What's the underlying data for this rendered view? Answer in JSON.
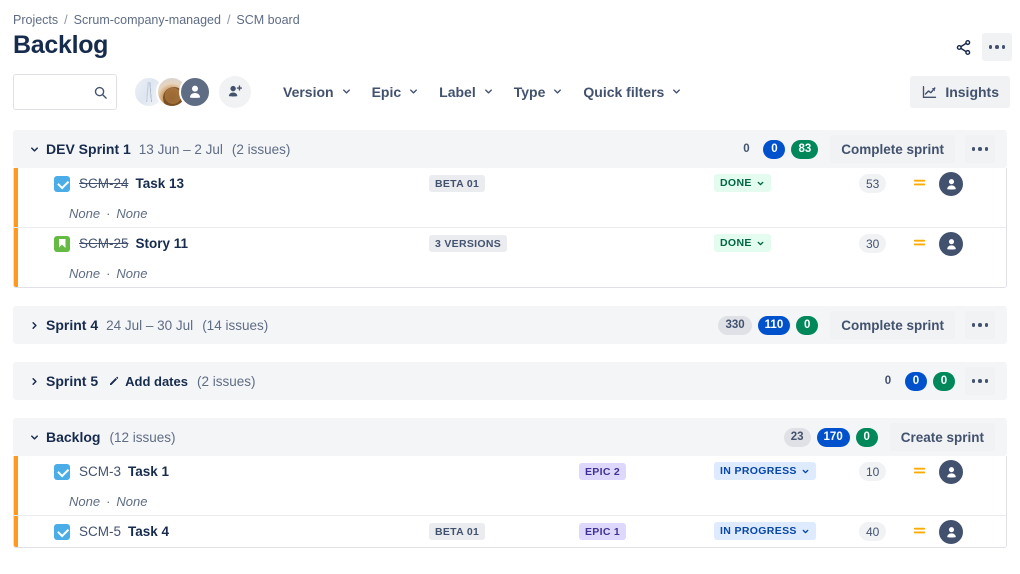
{
  "breadcrumb": {
    "items": [
      "Projects",
      "Scrum-company-managed",
      "SCM board"
    ],
    "separator": "/"
  },
  "page_title": "Backlog",
  "top_actions": {
    "share_icon": "share-icon",
    "more_icon": "more-options-icon"
  },
  "search": {
    "value": "",
    "placeholder": "",
    "icon": "search-icon"
  },
  "avatars": {
    "count": 3,
    "add_person_icon": "add-person-icon"
  },
  "filters": [
    {
      "label": "Version",
      "icon": "chevron-down-icon"
    },
    {
      "label": "Epic",
      "icon": "chevron-down-icon"
    },
    {
      "label": "Label",
      "icon": "chevron-down-icon"
    },
    {
      "label": "Type",
      "icon": "chevron-down-icon"
    },
    {
      "label": "Quick filters",
      "icon": "chevron-down-icon"
    }
  ],
  "insights": {
    "label": "Insights",
    "icon": "insights-chart-icon"
  },
  "colors": {
    "blue_pill": "#0052CC",
    "green_pill": "#00875A",
    "grey_pill": "#DFE1E6",
    "row_accent": "#FF991F",
    "done_bg": "#E3FCEF",
    "done_text": "#006644",
    "inprogress_bg": "#DEEBFF",
    "inprogress_text": "#0747A6",
    "epic_chip_bg": "#DFD8FD",
    "epic_chip_text": "#403294"
  },
  "sections": [
    {
      "id": "dev-sprint-1",
      "name": "DEV Sprint 1",
      "dates": "13 Jun – 2 Jul",
      "count": "(2 issues)",
      "expanded": true,
      "caret": "chevron-down-icon",
      "badges": [
        {
          "value": "0",
          "style": "plain"
        },
        {
          "value": "0",
          "style": "blue"
        },
        {
          "value": "83",
          "style": "green"
        }
      ],
      "action_label": "Complete sprint",
      "menu_icon": "more-options-icon",
      "issues": [
        {
          "type": "task",
          "type_icon": "task-icon",
          "key": "SCM-24",
          "key_done": true,
          "title": "Task 13",
          "sub": [
            "None",
            "None"
          ],
          "version": "BETA 01",
          "epic": "",
          "status": "DONE",
          "status_style": "done",
          "points": "53",
          "priority_icon": "priority-medium-icon",
          "assignee_icon": "assignee-avatar-icon"
        },
        {
          "type": "story",
          "type_icon": "story-icon",
          "key": "SCM-25",
          "key_done": true,
          "title": "Story 11",
          "sub": [
            "None",
            "None"
          ],
          "version": "3 VERSIONS",
          "epic": "",
          "status": "DONE",
          "status_style": "done",
          "points": "30",
          "priority_icon": "priority-medium-icon",
          "assignee_icon": "assignee-avatar-icon"
        }
      ]
    },
    {
      "id": "sprint-4",
      "name": "Sprint 4",
      "dates": "24 Jul – 30 Jul",
      "count": "(14 issues)",
      "expanded": false,
      "caret": "chevron-right-icon",
      "badges": [
        {
          "value": "330",
          "style": "grey"
        },
        {
          "value": "110",
          "style": "blue"
        },
        {
          "value": "0",
          "style": "green"
        }
      ],
      "action_label": "Complete sprint",
      "menu_icon": "more-options-icon",
      "issues": []
    },
    {
      "id": "sprint-5",
      "name": "Sprint 5",
      "dates": "",
      "add_dates_label": "Add dates",
      "add_dates_icon": "pencil-icon",
      "count": "(2 issues)",
      "expanded": false,
      "caret": "chevron-right-icon",
      "badges": [
        {
          "value": "0",
          "style": "plain"
        },
        {
          "value": "0",
          "style": "blue"
        },
        {
          "value": "0",
          "style": "green"
        }
      ],
      "action_label": "",
      "menu_icon": "more-options-icon",
      "issues": []
    },
    {
      "id": "backlog",
      "name": "Backlog",
      "dates": "",
      "count": "(12 issues)",
      "expanded": true,
      "caret": "chevron-down-icon",
      "badges": [
        {
          "value": "23",
          "style": "grey"
        },
        {
          "value": "170",
          "style": "blue"
        },
        {
          "value": "0",
          "style": "green"
        }
      ],
      "action_label": "Create sprint",
      "menu_icon": "",
      "issues": [
        {
          "type": "task",
          "type_icon": "task-icon",
          "key": "SCM-3",
          "key_done": false,
          "title": "Task 1",
          "sub": [
            "None",
            "None"
          ],
          "version": "",
          "epic": "EPIC 2",
          "status": "IN PROGRESS",
          "status_style": "inprogress",
          "points": "10",
          "priority_icon": "priority-medium-icon",
          "assignee_icon": "assignee-avatar-icon"
        },
        {
          "type": "task",
          "type_icon": "task-icon",
          "key": "SCM-5",
          "key_done": false,
          "title": "Task 4",
          "sub": [],
          "version": "BETA 01",
          "epic": "EPIC 1",
          "status": "IN PROGRESS",
          "status_style": "inprogress",
          "points": "40",
          "priority_icon": "priority-medium-icon",
          "assignee_icon": "assignee-avatar-icon"
        }
      ]
    }
  ]
}
